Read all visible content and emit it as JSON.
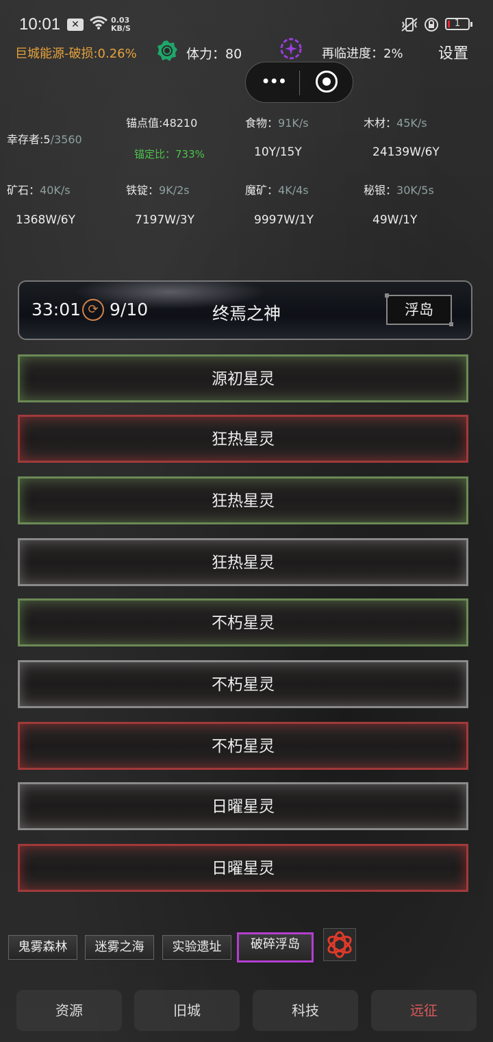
{
  "status_bar": {
    "time": "10:01",
    "x_badge": "✕",
    "speed_value": "0.03",
    "speed_unit": "KB/S",
    "battery": "1"
  },
  "top": {
    "energy": "巨城能源-破损:0.26%",
    "stamina": "体力：80",
    "revisit": "再临进度：2%",
    "settings": "设置"
  },
  "capsule": {
    "dots": "•••"
  },
  "stats": {
    "survivors_label": "幸存者:5",
    "survivors_max": "/3560",
    "anchor_value": "锚点值:48210",
    "anchor_ratio": "锚定比：733%",
    "food_label": "食物",
    "food_rate": "91K/s",
    "food_amount": "10Y/15Y",
    "wood_label": "木材",
    "wood_rate": "45K/s",
    "wood_amount": "24139W/6Y",
    "ore_label": "矿石",
    "ore_rate": "40K/s",
    "ore_amount": "1368W/6Y",
    "ingot_label": "铁锭",
    "ingot_rate": "9K/2s",
    "ingot_amount": "7197W/3Y",
    "magic_label": "魔矿",
    "magic_rate": "4K/4s",
    "magic_amount": "9997W/1Y",
    "mithril_label": "秘银",
    "mithril_rate": "30K/5s",
    "mithril_amount": "49W/1Y",
    "colon": "："
  },
  "boss": {
    "time": "33:01",
    "count": "9/10",
    "name": "终焉之神",
    "tag": "浮岛"
  },
  "spirits": [
    {
      "name": "源初星灵",
      "color": "green"
    },
    {
      "name": "狂热星灵",
      "color": "red"
    },
    {
      "name": "狂热星灵",
      "color": "green"
    },
    {
      "name": "狂热星灵",
      "color": "gray"
    },
    {
      "name": "不朽星灵",
      "color": "green"
    },
    {
      "name": "不朽星灵",
      "color": "gray"
    },
    {
      "name": "不朽星灵",
      "color": "red"
    },
    {
      "name": "日曜星灵",
      "color": "gray"
    },
    {
      "name": "日曜星灵",
      "color": "red"
    }
  ],
  "areas": [
    {
      "label": "鬼雾森林",
      "active": false
    },
    {
      "label": "迷雾之海",
      "active": false
    },
    {
      "label": "实验遗址",
      "active": false
    },
    {
      "label": "破碎浮岛",
      "active": true
    }
  ],
  "nav": [
    {
      "label": "资源"
    },
    {
      "label": "旧城"
    },
    {
      "label": "科技"
    },
    {
      "label": "远征"
    }
  ],
  "colors": {
    "energy": "#e6a23c",
    "active_tab": "#b43fd0",
    "spirit_green": "#6b8a55",
    "spirit_red": "#a13a3a",
    "spirit_gray": "#8a8a8a",
    "nav_highlight": "#e05a5a"
  }
}
